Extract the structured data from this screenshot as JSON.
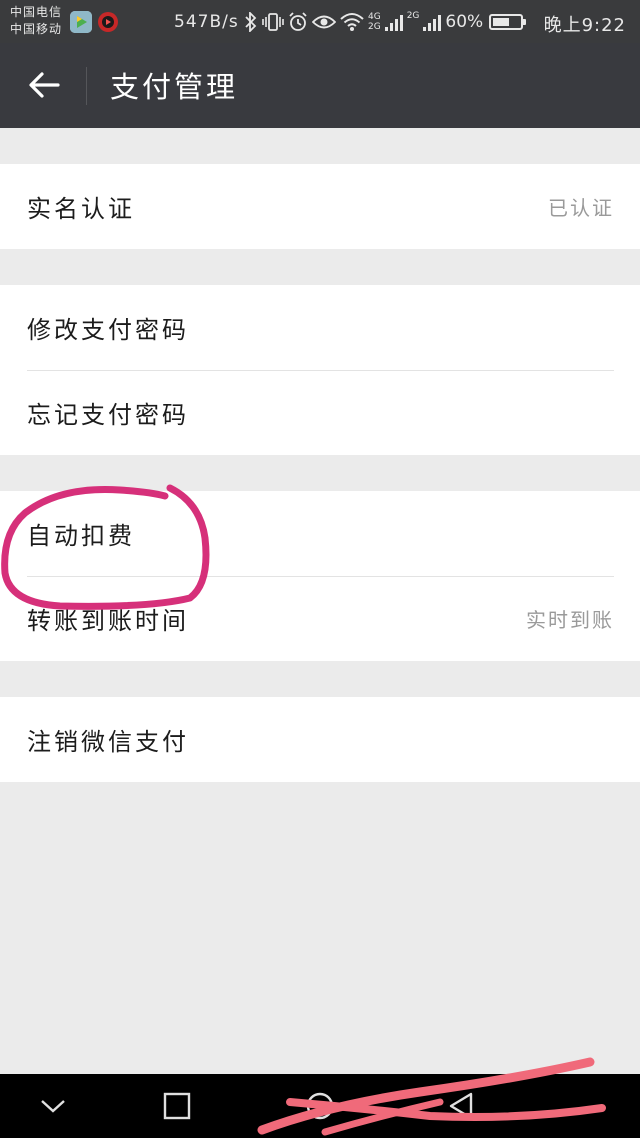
{
  "status_bar": {
    "carrier_1": "中国电信",
    "carrier_2": "中国移动",
    "net_speed": "547B/s",
    "net_type_top": "4G",
    "net_type_bottom": "2G",
    "net_type_2": "2G",
    "battery": "60%",
    "battery_level": 0.6,
    "time": "晚上9:22",
    "icons": [
      "video-app-icon",
      "music-app-icon",
      "bluetooth-icon",
      "vibrate-icon",
      "alarm-icon",
      "eye-icon",
      "wifi-icon",
      "signal-icon",
      "signal-icon",
      "battery-icon"
    ]
  },
  "title_bar": {
    "back_icon": "arrow-left-icon",
    "title": "支付管理"
  },
  "groups": [
    {
      "rows": [
        {
          "label": "实名认证",
          "value": "已认证"
        }
      ]
    },
    {
      "rows": [
        {
          "label": "修改支付密码",
          "value": ""
        },
        {
          "label": "忘记支付密码",
          "value": ""
        }
      ]
    },
    {
      "rows": [
        {
          "label": "自动扣费",
          "value": ""
        },
        {
          "label": "转账到账时间",
          "value": "实时到账"
        }
      ]
    },
    {
      "rows": [
        {
          "label": "注销微信支付",
          "value": ""
        }
      ]
    }
  ],
  "nav_bar": {
    "icons": [
      "chevron-down-icon",
      "square-icon",
      "circle-icon",
      "triangle-back-icon"
    ]
  },
  "colors": {
    "title_bar": "#393a3f",
    "background": "#ebebeb",
    "annotation": "#d6307a",
    "scribble": "#f06a7a"
  }
}
